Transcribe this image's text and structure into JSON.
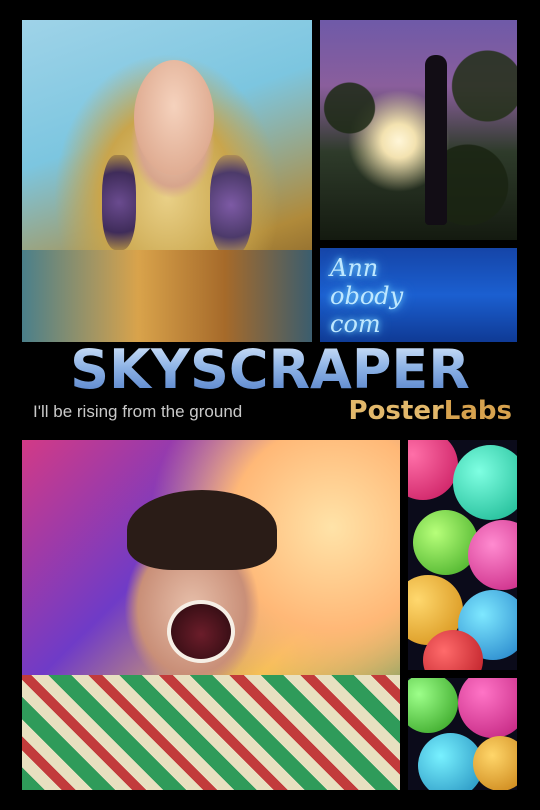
{
  "title": "SKYSCRAPER",
  "tagline": "I'll be rising from the ground",
  "brand": {
    "part1": "Poster",
    "part2": "Labs"
  },
  "neon_text": [
    "Ann",
    "obody",
    "com"
  ],
  "colors": {
    "background": "#000000",
    "title_gradient_top": "#d8e8fb",
    "title_gradient_bottom": "#4d7ac6",
    "brand": "#e2b86b",
    "tagline": "#c9c9c9"
  },
  "panels": [
    "woman-portrait",
    "silhouette-trees",
    "neon-script",
    "man-shouting",
    "colorful-bubbles-top",
    "colorful-bubbles-bottom"
  ]
}
